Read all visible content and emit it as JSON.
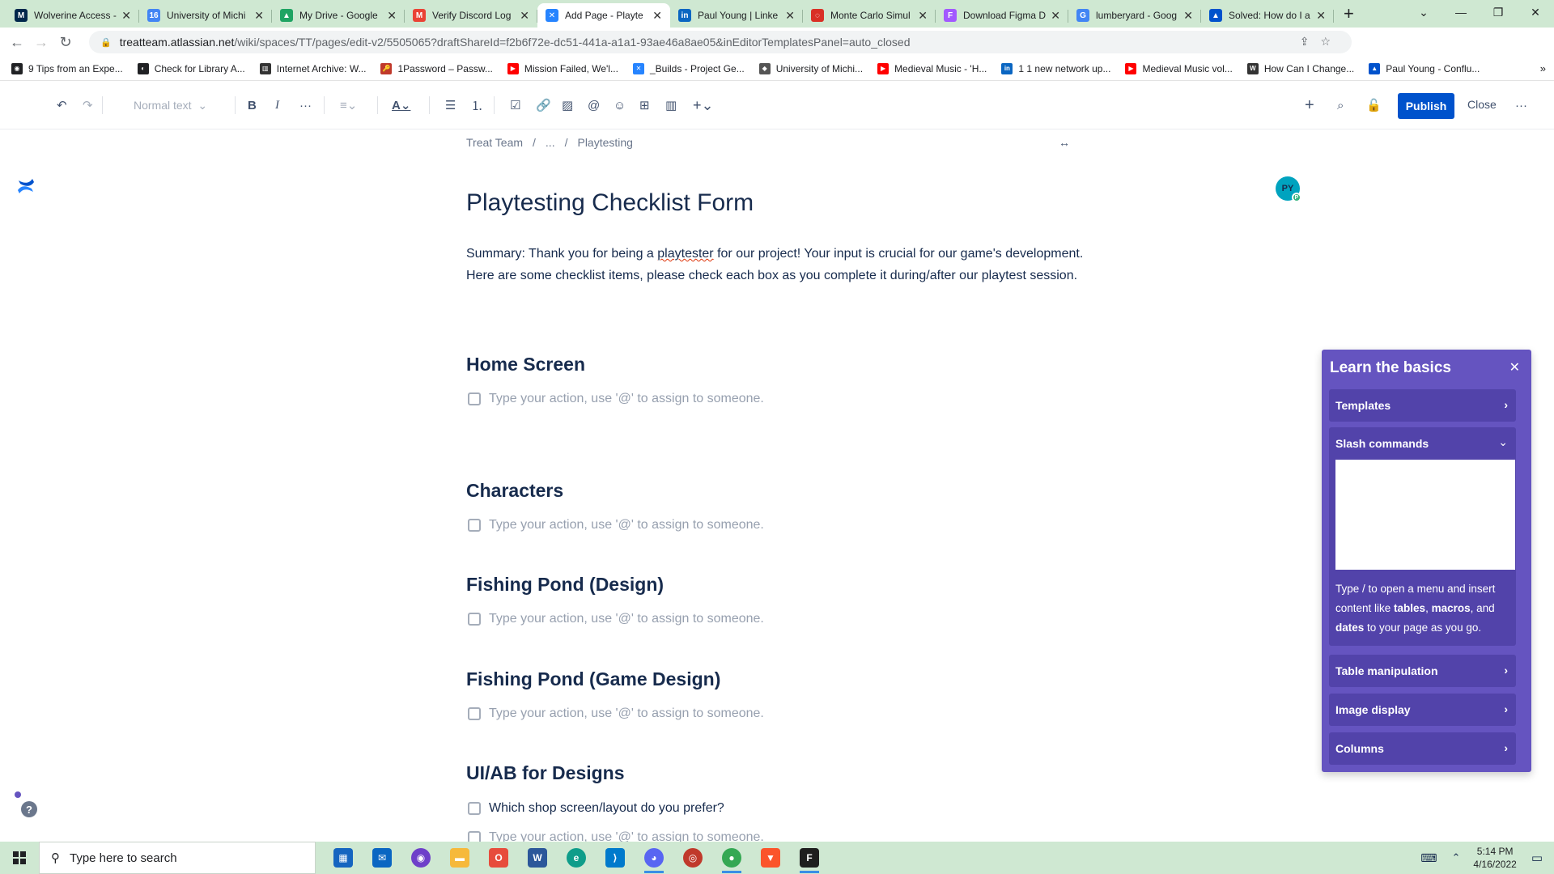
{
  "browser": {
    "tabs": [
      {
        "title": "Wolverine Access -",
        "fav_color": "#00274c",
        "fav_char": "M"
      },
      {
        "title": "University of Michi",
        "fav_color": "#4285f4",
        "fav_char": "16"
      },
      {
        "title": "My Drive - Google",
        "fav_color": "#1fa463",
        "fav_char": "▲"
      },
      {
        "title": "Verify Discord Log",
        "fav_color": "#ea4335",
        "fav_char": "M"
      },
      {
        "title": "Add Page - Playte",
        "fav_color": "#2684ff",
        "fav_char": "✕",
        "active": true
      },
      {
        "title": "Paul Young | Linke",
        "fav_color": "#0a66c2",
        "fav_char": "in"
      },
      {
        "title": "Monte Carlo Simul",
        "fav_color": "#d93025",
        "fav_char": "◌"
      },
      {
        "title": "Download Figma D",
        "fav_color": "#a259ff",
        "fav_char": "F"
      },
      {
        "title": "lumberyard - Goog",
        "fav_color": "#4285f4",
        "fav_char": "G"
      },
      {
        "title": "Solved: How do I a",
        "fav_color": "#0052cc",
        "fav_char": "▲"
      }
    ],
    "url_host": "treatteam.atlassian.net",
    "url_path": "/wiki/spaces/TT/pages/edit-v2/5505065?draftShareId=f2b6f72e-dc51-441a-a1a1-93ae46a8ae05&inEditorTemplatesPanel=auto_closed",
    "bookmarks": [
      {
        "label": "9 Tips from an Expe...",
        "color": "#202124",
        "char": "◉"
      },
      {
        "label": "Check for Library A...",
        "color": "#202124",
        "char": "◐"
      },
      {
        "label": "Internet Archive: W...",
        "color": "#333333",
        "char": "▥"
      },
      {
        "label": "1Password – Passw...",
        "color": "#c0392b",
        "char": "🔑"
      },
      {
        "label": "Mission Failed, We'l...",
        "color": "#ff0000",
        "char": "▶"
      },
      {
        "label": "_Builds - Project Ge...",
        "color": "#2684ff",
        "char": "✕"
      },
      {
        "label": "University of Michi...",
        "color": "#555555",
        "char": "◆"
      },
      {
        "label": "Medieval Music - 'H...",
        "color": "#ff0000",
        "char": "▶"
      },
      {
        "label": "1 1 new network up...",
        "color": "#0a66c2",
        "char": "in"
      },
      {
        "label": "Medieval Music vol...",
        "color": "#ff0000",
        "char": "▶"
      },
      {
        "label": "How Can I Change...",
        "color": "#333333",
        "char": "W"
      },
      {
        "label": "Paul Young - Conflu...",
        "color": "#0052cc",
        "char": "▲"
      }
    ]
  },
  "toolbar": {
    "text_style": "Normal text",
    "avatar_initials": "PY",
    "avatar_badge": "P",
    "publish_label": "Publish",
    "close_label": "Close"
  },
  "page": {
    "breadcrumb": [
      "Treat Team",
      "/",
      "...",
      "/",
      "Playtesting"
    ],
    "title": "Playtesting Checklist Form",
    "summary_line1_a": "Summary: Thank you for being a ",
    "summary_line1_spell": "playtester",
    "summary_line1_b": " for our project! Your input is crucial for our game's development.",
    "summary_line2": "Here are some checklist items, please check each box as you complete it during/after our playtest session.",
    "sections": [
      {
        "heading": "Home Screen",
        "tasks": [
          {
            "text": "Type your action, use '@' to assign to someone.",
            "placeholder": true
          }
        ]
      },
      {
        "heading": "Characters",
        "tasks": [
          {
            "text": "Type your action, use '@' to assign to someone.",
            "placeholder": true
          }
        ]
      },
      {
        "heading": "Fishing Pond (Design)",
        "tasks": [
          {
            "text": "Type your action, use '@' to assign to someone.",
            "placeholder": true
          }
        ]
      },
      {
        "heading": "Fishing Pond (Game Design)",
        "tasks": [
          {
            "text": "Type your action, use '@' to assign to someone.",
            "placeholder": true
          }
        ]
      },
      {
        "heading": "UI/AB for Designs",
        "tasks": [
          {
            "text": "Which shop screen/layout do you prefer?",
            "placeholder": false
          },
          {
            "text": "Type your action, use '@' to assign to someone.",
            "placeholder": true
          }
        ]
      }
    ]
  },
  "learn_panel": {
    "title": "Learn the basics",
    "templates": "Templates",
    "slash_commands": "Slash commands",
    "desc_a": "Type / to open a menu and insert content like ",
    "desc_tables": "tables",
    "desc_sep1": ", ",
    "desc_macros": "macros",
    "desc_sep2": ", and ",
    "desc_dates": "dates",
    "desc_b": " to your page as you go.",
    "table_manipulation": "Table manipulation",
    "image_display": "Image display",
    "columns": "Columns"
  },
  "taskbar": {
    "search_placeholder": "Type here to search",
    "time": "5:14 PM",
    "date": "4/16/2022"
  }
}
